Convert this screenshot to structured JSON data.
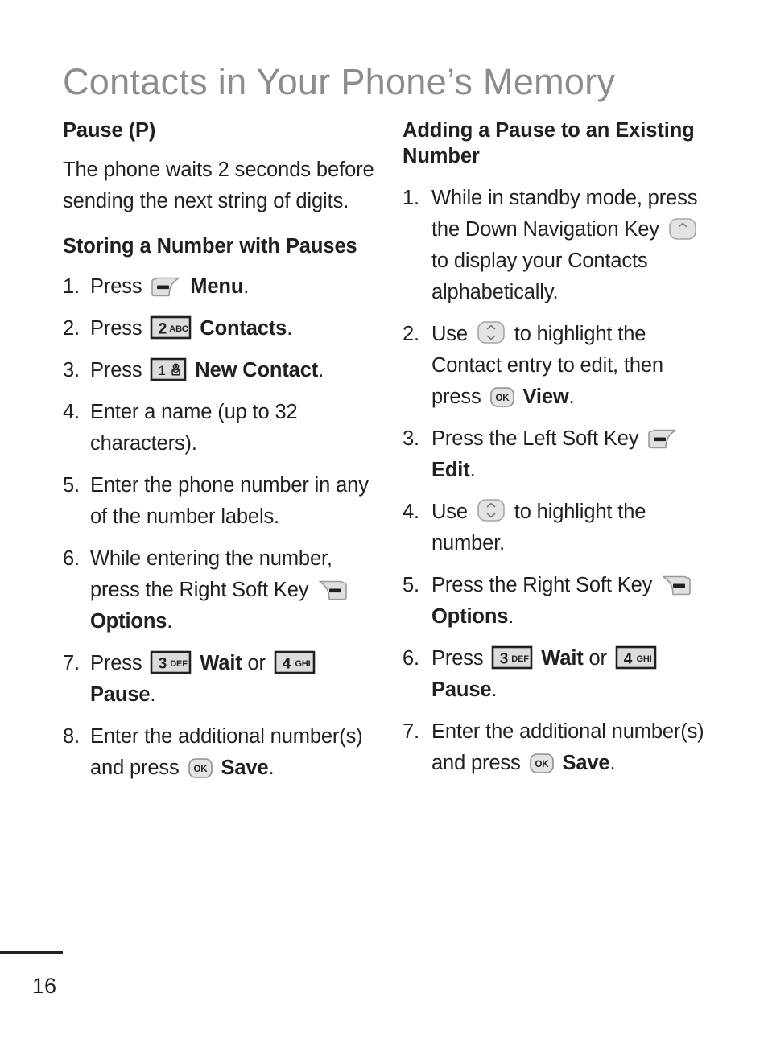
{
  "header": {
    "title": "Contacts in Your Phone’s Memory",
    "title_color": "#8c8c8c"
  },
  "footer": {
    "page_number": "16"
  },
  "icons": {
    "left_soft_key": "left-soft-key-icon",
    "right_soft_key": "right-soft-key-icon",
    "ok_key": "ok-key-icon",
    "nav_key_down": "navigation-key-down-icon",
    "nav_key_up_down": "navigation-key-up-down-icon",
    "key_1": "key-1-voicemail-icon",
    "key_2": "key-2-abc-icon",
    "key_3": "key-3-def-icon",
    "key_4": "key-4-ghi-icon",
    "ok_label": "OK",
    "key_1_digit": "1",
    "key_2_digit": "2",
    "key_2_letters": "ABC",
    "key_3_digit": "3",
    "key_3_letters": "DEF",
    "key_4_digit": "4",
    "key_4_letters": "GHI"
  },
  "left_column": {
    "heading_1": "Pause (P)",
    "paragraph_1": "The phone waits 2 seconds before sending the next string of digits.",
    "heading_2": "Storing a Number with Pauses",
    "steps": [
      {
        "num": "1.",
        "parts": [
          {
            "type": "text",
            "value": "Press "
          },
          {
            "type": "icon",
            "value": "left-soft-key-icon"
          },
          {
            "type": "bold",
            "value": " Menu"
          },
          {
            "type": "text",
            "value": "."
          }
        ]
      },
      {
        "num": "2.",
        "parts": [
          {
            "type": "text",
            "value": "Press "
          },
          {
            "type": "icon",
            "value": "key-2-abc-icon"
          },
          {
            "type": "bold",
            "value": " Contacts"
          },
          {
            "type": "text",
            "value": "."
          }
        ]
      },
      {
        "num": "3.",
        "parts": [
          {
            "type": "text",
            "value": "Press "
          },
          {
            "type": "icon",
            "value": "key-1-voicemail-icon"
          },
          {
            "type": "bold",
            "value": " New Contact"
          },
          {
            "type": "text",
            "value": "."
          }
        ]
      },
      {
        "num": "4.",
        "parts": [
          {
            "type": "text",
            "value": "Enter a name (up to 32 characters)."
          }
        ]
      },
      {
        "num": "5.",
        "parts": [
          {
            "type": "text",
            "value": "Enter the phone number in any of the number labels."
          }
        ]
      },
      {
        "num": "6.",
        "parts": [
          {
            "type": "text",
            "value": "While entering the number, press the Right Soft Key "
          },
          {
            "type": "icon",
            "value": "right-soft-key-icon"
          },
          {
            "type": "bold",
            "value": " Options"
          },
          {
            "type": "text",
            "value": "."
          }
        ]
      },
      {
        "num": "7.",
        "parts": [
          {
            "type": "text",
            "value": "Press "
          },
          {
            "type": "icon",
            "value": "key-3-def-icon"
          },
          {
            "type": "bold",
            "value": " Wait"
          },
          {
            "type": "text",
            "value": " or "
          },
          {
            "type": "icon",
            "value": "key-4-ghi-icon"
          },
          {
            "type": "bold",
            "value": " Pause"
          },
          {
            "type": "text",
            "value": "."
          }
        ]
      },
      {
        "num": "8.",
        "parts": [
          {
            "type": "text",
            "value": "Enter the additional number(s) and press "
          },
          {
            "type": "icon",
            "value": "ok-key-icon"
          },
          {
            "type": "bold",
            "value": " Save"
          },
          {
            "type": "text",
            "value": "."
          }
        ]
      }
    ]
  },
  "right_column": {
    "heading_1": "Adding a Pause to an Existing Number",
    "steps": [
      {
        "num": "1.",
        "parts": [
          {
            "type": "text",
            "value": "While in standby mode, press the Down Navigation Key "
          },
          {
            "type": "icon",
            "value": "navigation-key-down-icon"
          },
          {
            "type": "text",
            "value": " to display your Contacts alphabetically."
          }
        ]
      },
      {
        "num": "2.",
        "parts": [
          {
            "type": "text",
            "value": "Use "
          },
          {
            "type": "icon",
            "value": "navigation-key-up-down-icon"
          },
          {
            "type": "text",
            "value": " to highlight the Contact entry to edit, then press "
          },
          {
            "type": "icon",
            "value": "ok-key-icon"
          },
          {
            "type": "bold",
            "value": " View"
          },
          {
            "type": "text",
            "value": "."
          }
        ]
      },
      {
        "num": "3.",
        "parts": [
          {
            "type": "text",
            "value": "Press the Left Soft Key "
          },
          {
            "type": "icon",
            "value": "left-soft-key-icon"
          },
          {
            "type": "bold",
            "value": " Edit"
          },
          {
            "type": "text",
            "value": "."
          }
        ]
      },
      {
        "num": "4.",
        "parts": [
          {
            "type": "text",
            "value": "Use "
          },
          {
            "type": "icon",
            "value": "navigation-key-up-down-icon"
          },
          {
            "type": "text",
            "value": " to highlight the number."
          }
        ]
      },
      {
        "num": "5.",
        "parts": [
          {
            "type": "text",
            "value": "Press the Right Soft Key "
          },
          {
            "type": "icon",
            "value": "right-soft-key-icon"
          },
          {
            "type": "bold",
            "value": " Options"
          },
          {
            "type": "text",
            "value": "."
          }
        ]
      },
      {
        "num": "6.",
        "parts": [
          {
            "type": "text",
            "value": "Press "
          },
          {
            "type": "icon",
            "value": "key-3-def-icon"
          },
          {
            "type": "bold",
            "value": " Wait"
          },
          {
            "type": "text",
            "value": " or "
          },
          {
            "type": "icon",
            "value": "key-4-ghi-icon"
          },
          {
            "type": "bold",
            "value": " Pause"
          },
          {
            "type": "text",
            "value": "."
          }
        ]
      },
      {
        "num": "7.",
        "parts": [
          {
            "type": "text",
            "value": "Enter the additional number(s) and press "
          },
          {
            "type": "icon",
            "value": "ok-key-icon"
          },
          {
            "type": "bold",
            "value": " Save"
          },
          {
            "type": "text",
            "value": "."
          }
        ]
      }
    ]
  }
}
